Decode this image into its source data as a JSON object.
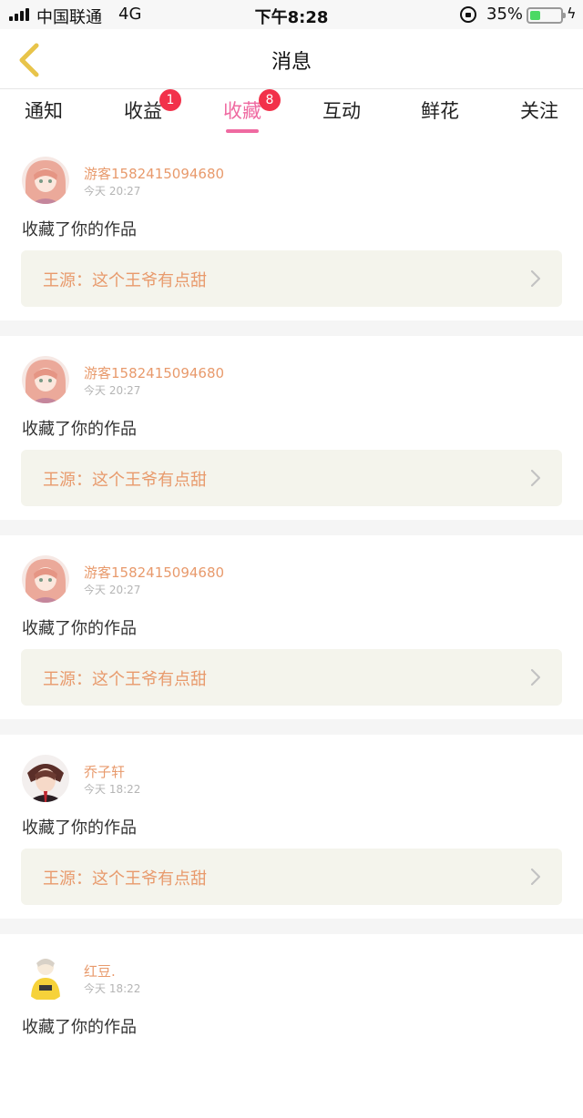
{
  "status_bar": {
    "carrier": "中国联通",
    "network": "4G",
    "time": "下午8:28",
    "battery_percent": "35%",
    "battery_level": 0.35,
    "battery_color": "#4cd964"
  },
  "nav": {
    "title": "消息",
    "back_icon": "chevron-left-icon",
    "back_color": "#e8c44a"
  },
  "tabs": [
    {
      "label": "通知",
      "badge": null,
      "active": false
    },
    {
      "label": "收益",
      "badge": "1",
      "active": false
    },
    {
      "label": "收藏",
      "badge": "8",
      "active": true
    },
    {
      "label": "互动",
      "badge": null,
      "active": false
    },
    {
      "label": "鲜花",
      "badge": null,
      "active": false
    },
    {
      "label": "关注",
      "badge": null,
      "active": false
    }
  ],
  "colors": {
    "accent_pink": "#ef6aa1",
    "badge_red": "#f2314a",
    "username_orange": "#e89a6c",
    "link_background": "#f4f4ec"
  },
  "feed": [
    {
      "username": "游客1582415094680",
      "time": "今天 20:27",
      "action": "收藏了你的作品",
      "work": "王源：这个王爷有点甜",
      "avatar": "anime-girl-avatar"
    },
    {
      "username": "游客1582415094680",
      "time": "今天 20:27",
      "action": "收藏了你的作品",
      "work": "王源：这个王爷有点甜",
      "avatar": "anime-girl-avatar"
    },
    {
      "username": "游客1582415094680",
      "time": "今天 20:27",
      "action": "收藏了你的作品",
      "work": "王源：这个王爷有点甜",
      "avatar": "anime-girl-avatar"
    },
    {
      "username": "乔子轩",
      "time": "今天 18:22",
      "action": "收藏了你的作品",
      "work": "王源：这个王爷有点甜",
      "avatar": "anime-boy-avatar"
    },
    {
      "username": "红豆.",
      "time": "今天 18:22",
      "action": "收藏了你的作品",
      "work": "",
      "avatar": "yellow-character-avatar"
    }
  ]
}
